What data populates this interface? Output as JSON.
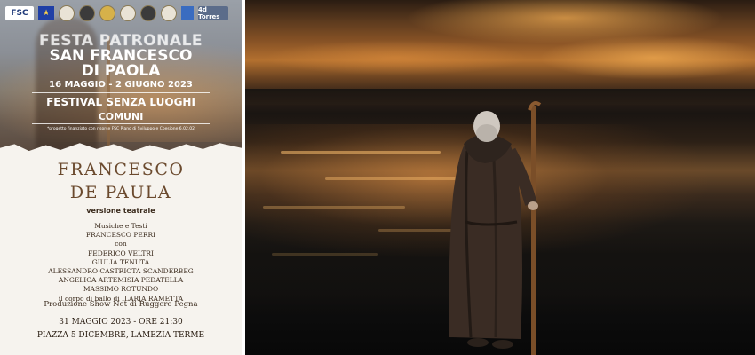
{
  "poster": {
    "logos": {
      "fsc": "FSC",
      "eu": "★",
      "torres": "4d Torres"
    },
    "festa_title": "FESTA PATRONALE",
    "saint_line1": "SAN FRANCESCO",
    "saint_line2": "DI PAOLA",
    "dates": "16 MAGGIO - 2 GIUGNO 2023",
    "festival": "FESTIVAL SENZA LUOGHI",
    "comuni": "COMUNI",
    "funding_note": "*progetto finanziato con risorse FSC Piano di Sviluppo e Coesione 6.02.02",
    "show_title_line1": "FRANCESCO",
    "show_title_line2": "DE PAULA",
    "version": "versione teatrale",
    "credits": [
      "Musiche e Testi",
      "FRANCESCO PERRI",
      "con",
      "FEDERICO VELTRI",
      "GIULIA TENUTA",
      "ALESSANDRO CASTRIOTA SCANDERBEG",
      "ANGELICA ARTEMISIA PEDATELLA",
      "MASSIMO ROTUNDO",
      "il corpo di ballo di ILARIA RAMETTA"
    ],
    "production": "Produzione Show Net di Ruggero Pegna",
    "event_datetime": "31 MAGGIO 2023 - ORE 21:30",
    "venue": "PIAZZA 5 DICEMBRE, LAMEZIA TERME"
  },
  "colors": {
    "title_brown": "#6b4a2e",
    "text_dark": "#3a2a1c",
    "sunset_orange": "#b3702f"
  }
}
